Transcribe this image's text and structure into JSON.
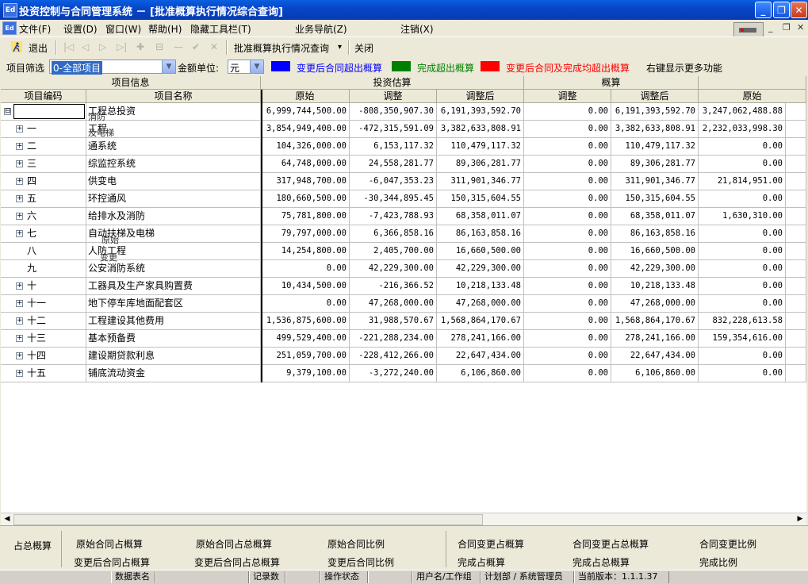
{
  "window": {
    "title": "投资控制与合同管理系统 － [批准概算执行情况综合查询]",
    "app_icon": "app-icon",
    "buttons": [
      "_",
      "❐",
      "✕"
    ]
  },
  "menubar": {
    "items": [
      "文件(F)",
      "设置(D)",
      "窗口(W)",
      "帮助(H)",
      "隐藏工具栏(T)",
      "业务导航(Z)",
      "注销(X)"
    ],
    "mdi_controls": [
      "_",
      "❐",
      "✕"
    ]
  },
  "toolbar": {
    "exit_label": "退出",
    "nav_glyphs": [
      "|◁",
      "◁",
      "▷",
      "▷|",
      "✚",
      "⊟",
      "—",
      "✔",
      "✕"
    ],
    "query_label": "批准概算执行情况查询",
    "query_arrow": "▾",
    "close_label": "关闭"
  },
  "filter": {
    "project_label": "项目筛选",
    "project_value": "0-全部项目",
    "unit_label": "金额单位:",
    "unit_value": "元",
    "legend": [
      {
        "color": "#0000ff",
        "text": "变更后合同超出概算",
        "text_color": "#0000ff"
      },
      {
        "color": "#008000",
        "text": "完成超出概算",
        "text_color": "#008000"
      },
      {
        "color": "#ff0000",
        "text": "变更后合同及完成均超出概算",
        "text_color": "#ff0000"
      }
    ],
    "right_click_hint": "右键显示更多功能"
  },
  "grid": {
    "group_headers": {
      "project_info": "项目信息",
      "estimate": "投资估算",
      "budget": "概算"
    },
    "columns": [
      "项目编码",
      "项目名称",
      "原始",
      "调整",
      "调整后",
      "调整",
      "调整后",
      "原始"
    ],
    "overlay_labels": [
      "消防",
      "及电梯",
      "原始",
      "变更"
    ],
    "rows": [
      {
        "code": "",
        "name": "工程总投资",
        "expander": "⊟",
        "v": [
          "6,999,744,500.00",
          "-808,350,907.30",
          "6,191,393,592.70",
          "0.00",
          "6,191,393,592.70",
          "3,247,062,488.88"
        ]
      },
      {
        "code": "一",
        "name": "工程",
        "expander": "+",
        "v": [
          "3,854,949,400.00",
          "-472,315,591.09",
          "3,382,633,808.91",
          "0.00",
          "3,382,633,808.91",
          "2,232,033,998.30"
        ]
      },
      {
        "code": "二",
        "name": "通系统",
        "expander": "+",
        "v": [
          "104,326,000.00",
          "6,153,117.32",
          "110,479,117.32",
          "0.00",
          "110,479,117.32",
          "0.00"
        ]
      },
      {
        "code": "三",
        "name": "综监控系统",
        "expander": "+",
        "v": [
          "64,748,000.00",
          "24,558,281.77",
          "89,306,281.77",
          "0.00",
          "89,306,281.77",
          "0.00"
        ]
      },
      {
        "code": "四",
        "name": "供变电",
        "expander": "+",
        "v": [
          "317,948,700.00",
          "-6,047,353.23",
          "311,901,346.77",
          "0.00",
          "311,901,346.77",
          "21,814,951.00"
        ]
      },
      {
        "code": "五",
        "name": "环控通风",
        "expander": "+",
        "v": [
          "180,660,500.00",
          "-30,344,895.45",
          "150,315,604.55",
          "0.00",
          "150,315,604.55",
          "0.00"
        ]
      },
      {
        "code": "六",
        "name": "给排水及消防",
        "expander": "+",
        "v": [
          "75,781,800.00",
          "-7,423,788.93",
          "68,358,011.07",
          "0.00",
          "68,358,011.07",
          "1,630,310.00"
        ]
      },
      {
        "code": "七",
        "name": "自动扶梯及电梯",
        "expander": "+",
        "v": [
          "79,797,000.00",
          "6,366,858.16",
          "86,163,858.16",
          "0.00",
          "86,163,858.16",
          "0.00"
        ]
      },
      {
        "code": "八",
        "name": "人防工程",
        "expander": "",
        "v": [
          "14,254,800.00",
          "2,405,700.00",
          "16,660,500.00",
          "0.00",
          "16,660,500.00",
          "0.00"
        ]
      },
      {
        "code": "九",
        "name": "公安消防系统",
        "expander": "",
        "v": [
          "0.00",
          "42,229,300.00",
          "42,229,300.00",
          "0.00",
          "42,229,300.00",
          "0.00"
        ]
      },
      {
        "code": "十",
        "name": "工器具及生产家具购置费",
        "expander": "+",
        "v": [
          "10,434,500.00",
          "-216,366.52",
          "10,218,133.48",
          "0.00",
          "10,218,133.48",
          "0.00"
        ]
      },
      {
        "code": "十一",
        "name": "地下停车库地面配套区",
        "expander": "+",
        "v": [
          "0.00",
          "47,268,000.00",
          "47,268,000.00",
          "0.00",
          "47,268,000.00",
          "0.00"
        ]
      },
      {
        "code": "十二",
        "name": "工程建设其他费用",
        "expander": "+",
        "v": [
          "1,536,875,600.00",
          "31,988,570.67",
          "1,568,864,170.67",
          "0.00",
          "1,568,864,170.67",
          "832,228,613.58"
        ]
      },
      {
        "code": "十三",
        "name": "基本预备费",
        "expander": "+",
        "v": [
          "499,529,400.00",
          "-221,288,234.00",
          "278,241,166.00",
          "0.00",
          "278,241,166.00",
          "159,354,616.00"
        ]
      },
      {
        "code": "十四",
        "name": "建设期贷款利息",
        "expander": "+",
        "v": [
          "251,059,700.00",
          "-228,412,266.00",
          "22,647,434.00",
          "0.00",
          "22,647,434.00",
          "0.00"
        ]
      },
      {
        "code": "十五",
        "name": "铺底流动资金",
        "expander": "+",
        "v": [
          "9,379,100.00",
          "-3,272,240.00",
          "6,106,860.00",
          "0.00",
          "6,106,860.00",
          "0.00"
        ]
      }
    ]
  },
  "summary": {
    "title": "占总概算",
    "row1": [
      "原始合同占概算",
      "原始合同占总概算",
      "原始合同比例",
      "合同变更占概算",
      "合同变更占总概算",
      "合同变更比例"
    ],
    "row2": [
      "变更后合同占概算",
      "变更后合同占总概算",
      "变更后合同比例",
      "完成占概算",
      "完成占总概算",
      "完成比例"
    ]
  },
  "statusbar": {
    "cells": [
      "数据表名",
      "",
      "记录数",
      "",
      "操作状态",
      "",
      "用户名/工作组",
      "计划部 / 系统管理员",
      "当前版本：1.1.1.37"
    ]
  }
}
